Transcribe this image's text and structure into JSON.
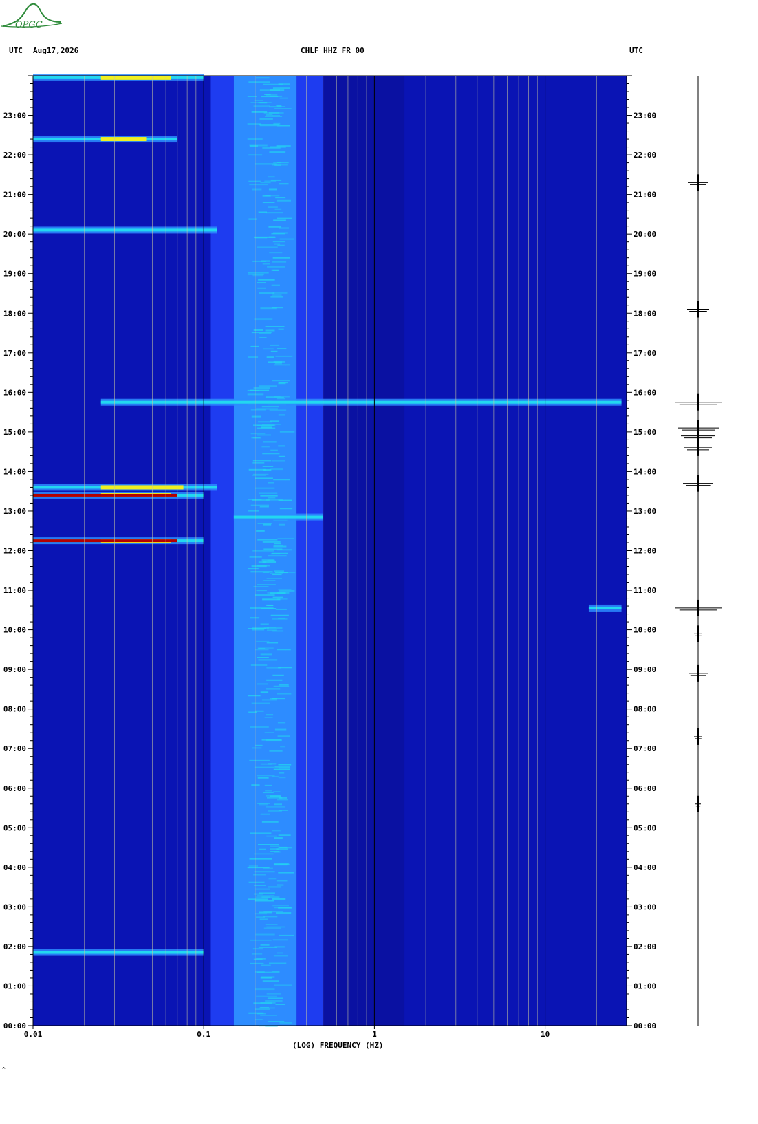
{
  "header": {
    "left_tz": "UTC",
    "date": "Aug17,2026",
    "station": "CHLF HHZ FR 00",
    "right_tz": "UTC"
  },
  "logo": {
    "text": "OPGC",
    "color": "#2e8b3a"
  },
  "footer_mark": "^",
  "colors": {
    "background": "#0a14b4",
    "deep": "#0a0f96",
    "mid": "#1e3cf0",
    "light": "#2d8cff",
    "cyan": "#22d8f0",
    "yellow": "#f0f020",
    "red": "#b40000",
    "gridline": "#c8c8a0",
    "decade_line": "#000000"
  },
  "chart_data": {
    "type": "heatmap",
    "title": "CHLF HHZ FR 00",
    "xlabel": "(LOG) FREQUENCY (HZ)",
    "x_scale": "log",
    "xlim": [
      0.01,
      30
    ],
    "x_tick_labels": [
      {
        "value": 0.01,
        "label": "0.01"
      },
      {
        "value": 0.1,
        "label": "0.1"
      },
      {
        "value": 1,
        "label": "1"
      },
      {
        "value": 10,
        "label": "10"
      }
    ],
    "ylim_hours": [
      0,
      24
    ],
    "y_tick_labels": [
      "00:00",
      "01:00",
      "02:00",
      "03:00",
      "04:00",
      "05:00",
      "06:00",
      "07:00",
      "08:00",
      "09:00",
      "10:00",
      "11:00",
      "12:00",
      "13:00",
      "14:00",
      "15:00",
      "16:00",
      "17:00",
      "18:00",
      "19:00",
      "20:00",
      "21:00",
      "22:00",
      "23:00"
    ],
    "background_band": {
      "f_low": 0.15,
      "f_high": 0.35,
      "level": "light-blue"
    },
    "events": [
      {
        "time": 23.95,
        "f_low": 0.01,
        "f_high": 0.1,
        "peak": "yellow"
      },
      {
        "time": 22.4,
        "f_low": 0.01,
        "f_high": 0.07,
        "peak": "yellow"
      },
      {
        "time": 20.1,
        "f_low": 0.01,
        "f_high": 0.12,
        "peak": "cyan"
      },
      {
        "time": 15.75,
        "f_low": 0.025,
        "f_high": 28,
        "peak": "cyan"
      },
      {
        "time": 13.6,
        "f_low": 0.01,
        "f_high": 0.12,
        "peak": "yellow"
      },
      {
        "time": 13.4,
        "f_low": 0.01,
        "f_high": 0.1,
        "peak": "red"
      },
      {
        "time": 12.85,
        "f_low": 0.15,
        "f_high": 0.5,
        "peak": "cyan"
      },
      {
        "time": 12.25,
        "f_low": 0.01,
        "f_high": 0.1,
        "peak": "red"
      },
      {
        "time": 10.55,
        "f_low": 18,
        "f_high": 28,
        "peak": "cyan"
      },
      {
        "time": 1.85,
        "f_low": 0.01,
        "f_high": 0.1,
        "peak": "cyan"
      }
    ],
    "seismogram_events_hours": [
      21.3,
      18.1,
      15.75,
      15.1,
      14.9,
      14.6,
      13.7,
      10.55,
      9.9,
      8.9,
      7.3,
      5.6
    ]
  }
}
